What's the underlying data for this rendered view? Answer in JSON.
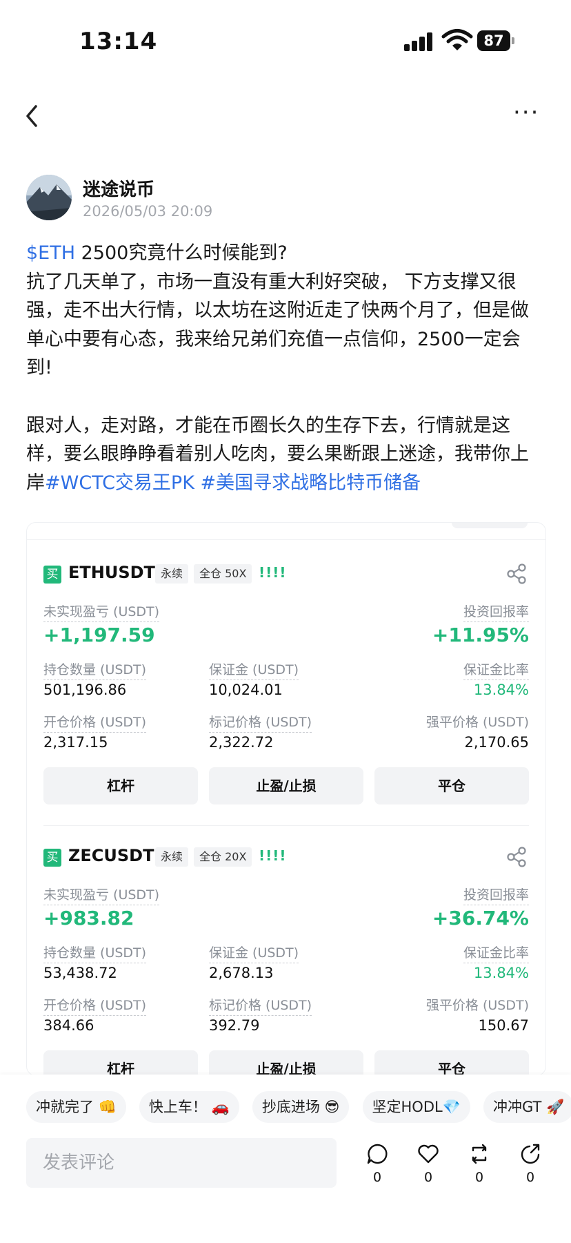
{
  "status_bar": {
    "time": "13:14",
    "battery": "87"
  },
  "post": {
    "author": "迷途说币",
    "date": "2026/05/03 20:09",
    "ticker": "$ETH",
    "line1_rest": "  2500究竟什么时候能到?",
    "para1": "抗了几天单了，市场一直没有重大利好突破， 下方支撑又很强，走不出大行情，以太坊在这附近走了快两个月了，但是做单心中要有心态，我来给兄弟们充值一点信仰，2500一定会到!",
    "para2": "跟对人，走对路，才能在币圈长久的生存下去，行情就是这样，要么眼睁睁看着别人吃肉，要么果断跟上迷途，我带你上岸",
    "hashtag1": "#WCTC交易王PK",
    "hashtag2": "#美国寻求战略比特币储备"
  },
  "positions": [
    {
      "side": "买",
      "symbol": "ETHUSDT",
      "type": "永续",
      "mode": "全仓 50X",
      "bars": "!!!!",
      "labels": {
        "pnl": "未实现盈亏 (USDT)",
        "roi": "投资回报率",
        "size": "持仓数量 (USDT)",
        "margin": "保证金 (USDT)",
        "margin_ratio": "保证金比率",
        "entry": "开仓价格 (USDT)",
        "mark": "标记价格 (USDT)",
        "liq": "强平价格 (USDT)"
      },
      "pnl": "+1,197.59",
      "roi": "+11.95%",
      "size": "501,196.86",
      "margin": "10,024.01",
      "margin_ratio": "13.84%",
      "entry": "2,317.15",
      "mark": "2,322.72",
      "liq": "2,170.65",
      "buttons": {
        "leverage": "杠杆",
        "tpsl": "止盈/止损",
        "close": "平仓"
      }
    },
    {
      "side": "买",
      "symbol": "ZECUSDT",
      "type": "永续",
      "mode": "全仓 20X",
      "bars": "!!!!",
      "labels": {
        "pnl": "未实现盈亏 (USDT)",
        "roi": "投资回报率",
        "size": "持仓数量 (USDT)",
        "margin": "保证金 (USDT)",
        "margin_ratio": "保证金比率",
        "entry": "开仓价格 (USDT)",
        "mark": "标记价格 (USDT)",
        "liq": "强平价格 (USDT)"
      },
      "pnl": "+983.82",
      "roi": "+36.74%",
      "size": "53,438.72",
      "margin": "2,678.13",
      "margin_ratio": "13.84%",
      "entry": "384.66",
      "mark": "392.79",
      "liq": "150.67",
      "buttons": {
        "leverage": "杠杆",
        "tpsl": "止盈/止损",
        "close": "平仓"
      }
    }
  ],
  "quick_replies": [
    "冲就完了 👊",
    "快上车！ 🚗",
    "抄底进场 😎",
    "坚定HODL💎",
    "冲冲GT 🚀"
  ],
  "comment_placeholder": "发表评论",
  "actions": {
    "comments": "0",
    "likes": "0",
    "reposts": "0",
    "shares": "0"
  },
  "colors": {
    "accent_green": "#21b87a",
    "link_blue": "#2f6fe4"
  }
}
